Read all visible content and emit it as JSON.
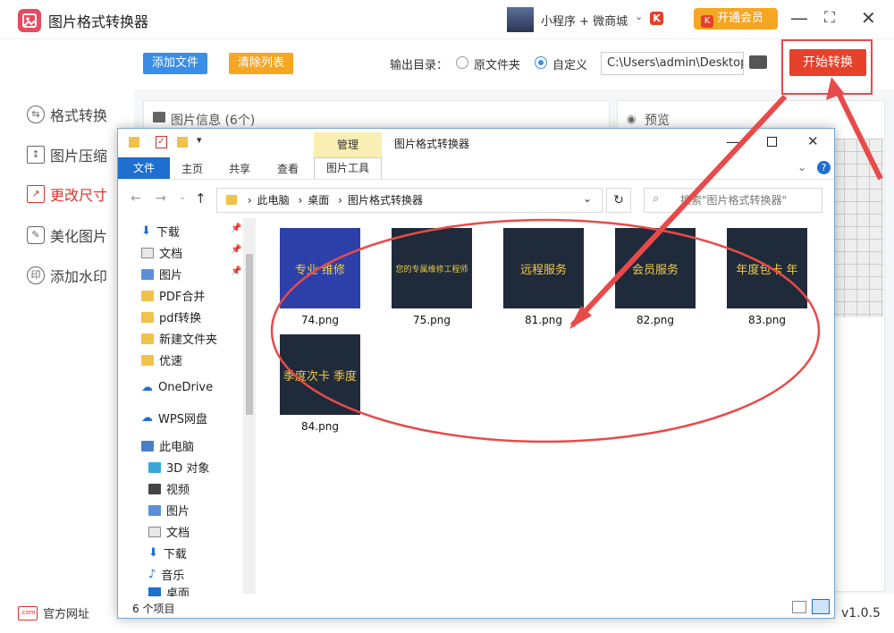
{
  "app": {
    "title": "图片格式转换器",
    "mini_text": "小程序 + 微商城",
    "vip": "开通会员",
    "version": "v1.0.5",
    "website": "官方网址"
  },
  "sidebar": {
    "items": [
      {
        "label": "格式转换"
      },
      {
        "label": "图片压缩"
      },
      {
        "label": "更改尺寸"
      },
      {
        "label": "美化图片"
      },
      {
        "label": "添加水印"
      }
    ]
  },
  "toolbar": {
    "add_label": "添加文件",
    "clear_label": "清除列表",
    "output_label": "输出目录：",
    "opt_original": "原文件夹",
    "opt_custom": "自定义",
    "path": "C:\\Users\\admin\\Desktop",
    "start_label": "开始转换"
  },
  "panels": {
    "info": "图片信息 (6个)",
    "preview": "预览"
  },
  "explorer": {
    "title": "图片格式转换器",
    "manage": "管理",
    "tabs": {
      "file": "文件",
      "home": "主页",
      "share": "共享",
      "view": "查看",
      "tools": "图片工具"
    },
    "breadcrumb": [
      "此电脑",
      "桌面",
      "图片格式转换器"
    ],
    "search_placeholder": "搜索\"图片格式转换器\"",
    "nav": [
      "下载",
      "文档",
      "图片",
      "PDF合并",
      "pdf转换",
      "新建文件夹",
      "优速",
      "OneDrive",
      "WPS网盘",
      "此电脑",
      "3D 对象",
      "视频",
      "图片",
      "文档",
      "下载",
      "音乐",
      "桌面"
    ],
    "files": [
      {
        "name": "74.png",
        "text": "专业 维修"
      },
      {
        "name": "75.png",
        "text": "您的专属维修工程师"
      },
      {
        "name": "81.png",
        "text": "远程服务"
      },
      {
        "name": "82.png",
        "text": "会员服务"
      },
      {
        "name": "83.png",
        "text": "年度包卡 年"
      },
      {
        "name": "84.png",
        "text": "季度次卡 季度"
      }
    ],
    "status": "6 个项目"
  },
  "colors": {
    "accent": "#e8402a",
    "blue": "#3a8ee6",
    "yellow": "#f5a623",
    "annotation": "#e84a4a"
  }
}
